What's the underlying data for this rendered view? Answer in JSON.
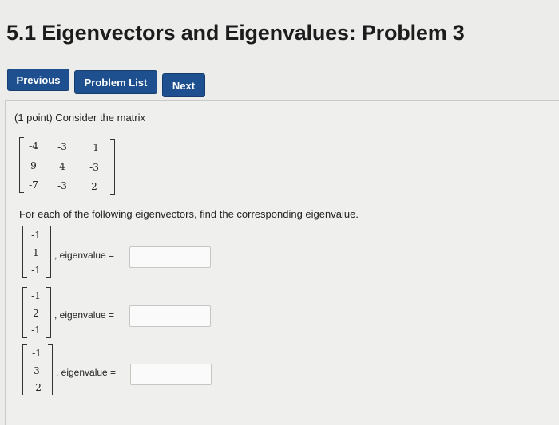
{
  "page": {
    "title": "5.1 Eigenvectors and Eigenvalues: Problem 3"
  },
  "nav": {
    "previous_label": "Previous",
    "problem_list_label": "Problem List",
    "next_label": "Next"
  },
  "problem": {
    "intro": "(1 point) Consider the matrix",
    "matrix": [
      [
        "-4",
        "-3",
        "-1"
      ],
      [
        "9",
        "4",
        "-3"
      ],
      [
        "-7",
        "-3",
        "2"
      ]
    ],
    "instruction": "For each of the following eigenvectors, find the corresponding eigenvalue.",
    "eigenvectors": [
      {
        "components": [
          "-1",
          "1",
          "-1"
        ],
        "label": ", eigenvalue =",
        "answer": ""
      },
      {
        "components": [
          "-1",
          "2",
          "-1"
        ],
        "label": ", eigenvalue =",
        "answer": ""
      },
      {
        "components": [
          "-1",
          "3",
          "-2"
        ],
        "label": ", eigenvalue =",
        "answer": ""
      }
    ]
  }
}
